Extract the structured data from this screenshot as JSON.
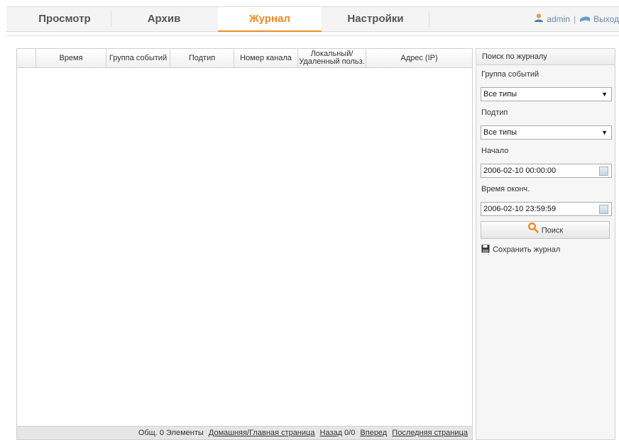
{
  "nav": {
    "tabs": [
      {
        "label": "Просмотр",
        "active": false
      },
      {
        "label": "Архив",
        "active": false
      },
      {
        "label": "Журнал",
        "active": true
      },
      {
        "label": "Настройки",
        "active": false
      }
    ],
    "user": "admin",
    "logout": "Выход"
  },
  "table": {
    "columns": [
      "Время",
      "Группа событий",
      "Подтип",
      "Номер канала",
      "Локальный/ Удаленный польз.",
      "Адрес (IP)"
    ],
    "rows": []
  },
  "pager": {
    "total": "Общ. 0 Элементы",
    "home": "Домашняя/Главная страница",
    "prev": "Назад",
    "page": "0/0",
    "next": "Вперед",
    "last": "Последняя страница"
  },
  "search": {
    "header": "Поиск по журналу",
    "event_group_label": "Группа событий",
    "event_group_value": "Все типы",
    "subtype_label": "Подтип",
    "subtype_value": "Все типы",
    "start_label": "Начало",
    "start_value": "2006-02-10 00:00:00",
    "end_label": "Время оконч.",
    "end_value": "2006-02-10 23:59:59",
    "search_button": "Поиск",
    "save_log": "Сохранить журнал"
  },
  "colors": {
    "accent": "#f08a24",
    "link": "#6a8ab0"
  }
}
